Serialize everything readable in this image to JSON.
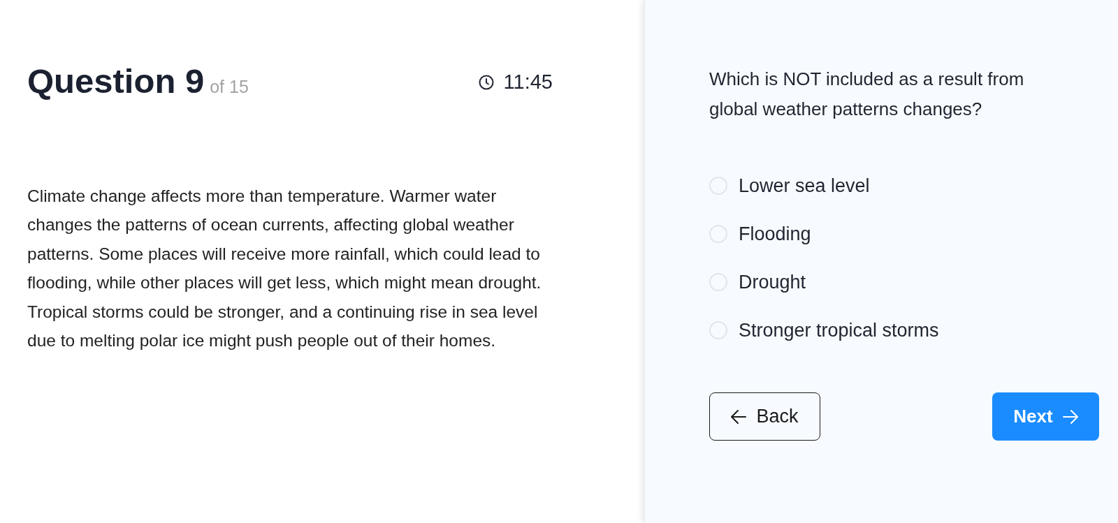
{
  "header": {
    "title": "Question 9",
    "count": "of 15",
    "timer": "11:45"
  },
  "passage": "Climate change affects more than temperature. Warmer water changes the patterns of ocean currents, affecting global weather patterns. Some places will receive more rainfall, which could lead to flooding, while other places will get less, which might mean drought. Tropical storms could be stronger, and a continuing rise in sea level due to melting polar ice might push people out of their homes.",
  "question": {
    "text": "Which is NOT included as a result from global weather patterns changes?",
    "options": [
      {
        "label": "Lower sea level",
        "selected": false
      },
      {
        "label": "Flooding",
        "selected": false
      },
      {
        "label": "Drought",
        "selected": false
      },
      {
        "label": "Stronger tropical storms",
        "selected": false
      }
    ]
  },
  "buttons": [
    {
      "label": "Back",
      "kind": "back"
    },
    {
      "label": "Next",
      "kind": "next"
    }
  ]
}
